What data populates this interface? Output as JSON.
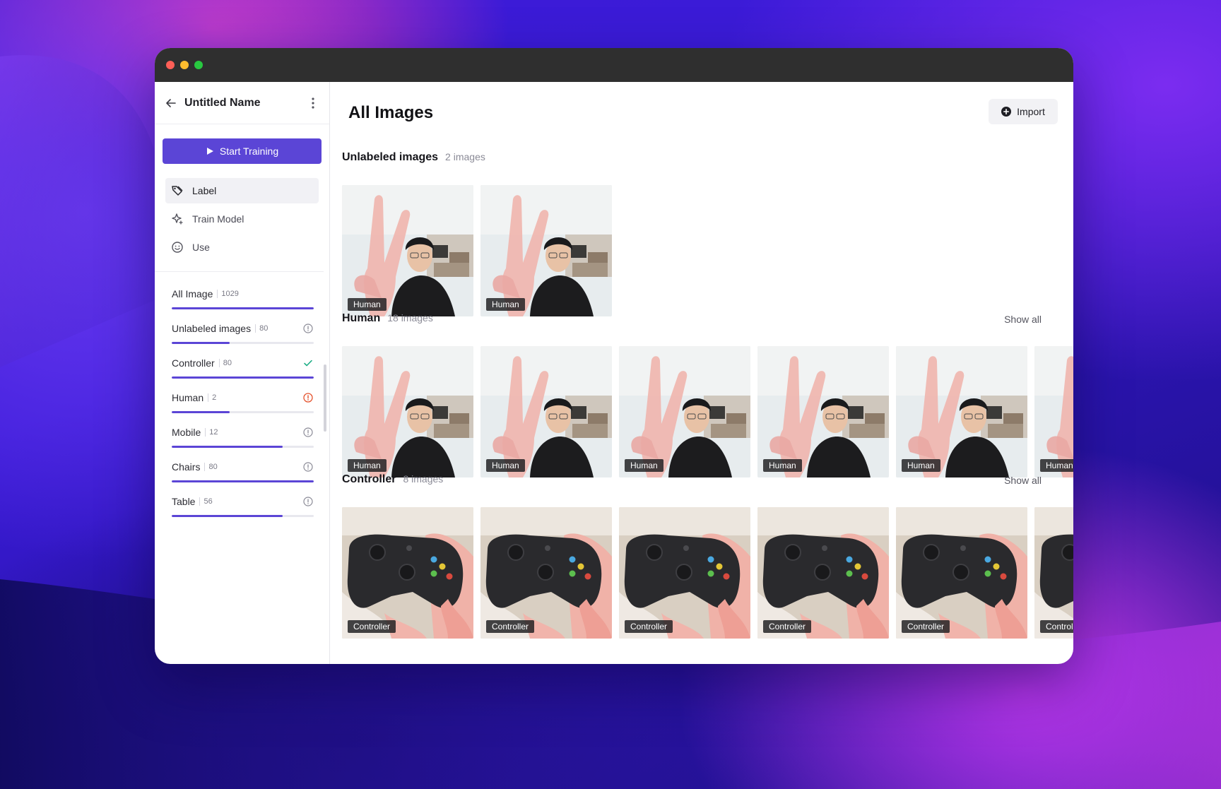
{
  "app": {
    "title": "Untitled Name",
    "start_training_label": "Start Training",
    "accent": "#5b45d6"
  },
  "nav": [
    {
      "label": "Label",
      "icon": "tag-icon",
      "active": true
    },
    {
      "label": "Train Model",
      "icon": "sparkle-icon",
      "active": false
    },
    {
      "label": "Use",
      "icon": "smiley-icon",
      "active": false
    }
  ],
  "categories": [
    {
      "name": "All Image",
      "count": "1029",
      "progress": 1.0,
      "status": "none"
    },
    {
      "name": "Unlabeled images",
      "count": "80",
      "progress": 0.41,
      "status": "info"
    },
    {
      "name": "Controller",
      "count": "80",
      "progress": 1.0,
      "status": "check"
    },
    {
      "name": "Human",
      "count": "2",
      "progress": 0.41,
      "status": "warning"
    },
    {
      "name": "Mobile",
      "count": "12",
      "progress": 0.78,
      "status": "info"
    },
    {
      "name": "Chairs",
      "count": "80",
      "progress": 1.0,
      "status": "info"
    },
    {
      "name": "Table",
      "count": "56",
      "progress": 0.78,
      "status": "info"
    }
  ],
  "main": {
    "title": "All Images",
    "import_label": "Import",
    "sections": [
      {
        "title": "Unlabeled images",
        "count": "2 images",
        "show_all": "",
        "thumb_label": "Human",
        "thumb_type": "human",
        "thumbs": 2
      },
      {
        "title": "Human",
        "count": "18 images",
        "show_all": "Show all",
        "thumb_label": "Human",
        "thumb_type": "human",
        "thumbs": 6
      },
      {
        "title": "Controller",
        "count": "8 images",
        "show_all": "Show all",
        "thumb_label": "Controller",
        "thumb_type": "controller",
        "thumbs": 6
      }
    ]
  }
}
